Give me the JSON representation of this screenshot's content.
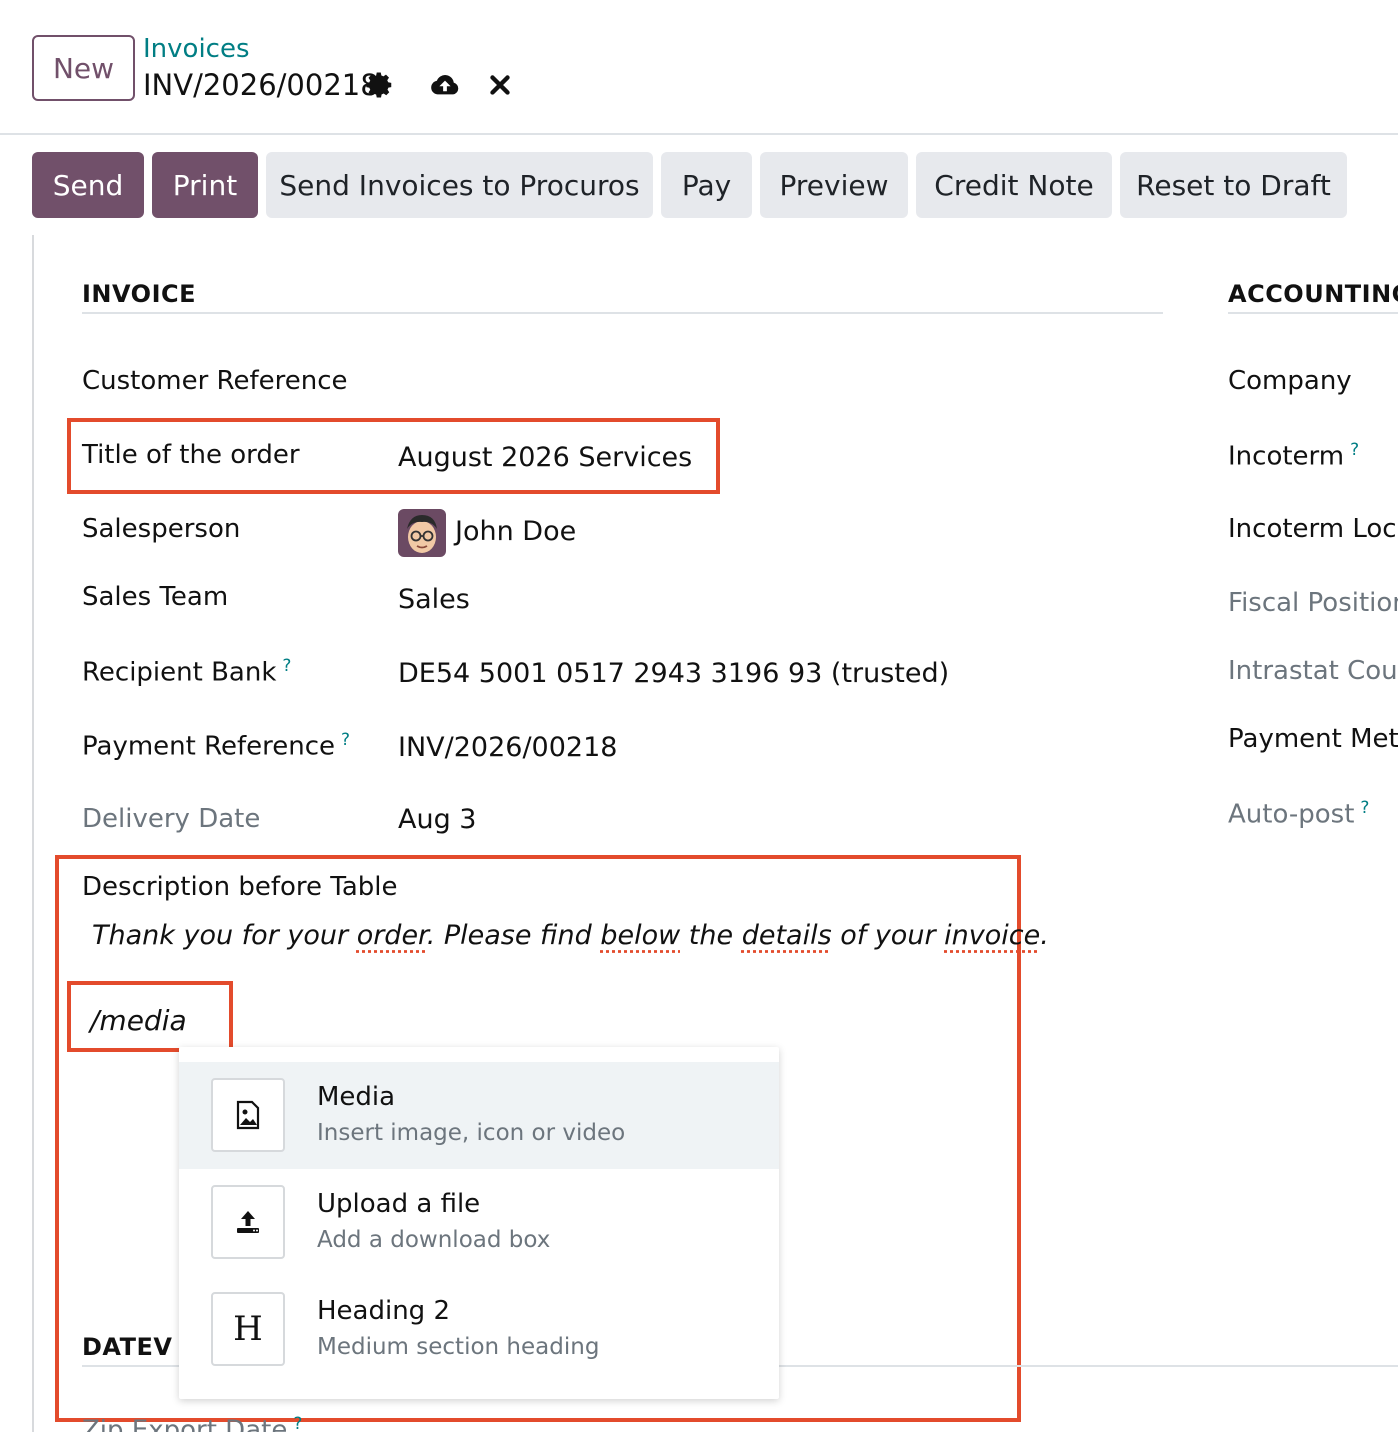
{
  "control_panel": {
    "new_label": "New",
    "breadcrumb": "Invoices",
    "record_name": "INV/2026/00218"
  },
  "status_buttons": [
    {
      "label": "Send",
      "style": "primary"
    },
    {
      "label": "Print",
      "style": "primary"
    },
    {
      "label": "Send Invoices to Procuros",
      "style": "secondary"
    },
    {
      "label": "Pay",
      "style": "secondary"
    },
    {
      "label": "Preview",
      "style": "secondary"
    },
    {
      "label": "Credit Note",
      "style": "secondary"
    },
    {
      "label": "Reset to Draft",
      "style": "secondary"
    }
  ],
  "invoice_section": {
    "title": "INVOICE",
    "fields": {
      "customer_reference": {
        "label": "Customer Reference",
        "value": ""
      },
      "title_of_order": {
        "label": "Title of the order",
        "value": "August 2026 Services"
      },
      "salesperson": {
        "label": "Salesperson",
        "value": "John Doe"
      },
      "sales_team": {
        "label": "Sales Team",
        "value": "Sales"
      },
      "recipient_bank": {
        "label": "Recipient Bank",
        "help": "?",
        "value": "DE54 5001 0517 2943 3196 93 (trusted)"
      },
      "payment_reference": {
        "label": "Payment Reference",
        "help": "?",
        "value": "INV/2026/00218"
      },
      "delivery_date": {
        "label": "Delivery Date",
        "value": "Aug 3"
      }
    },
    "description_label": "Description before Table",
    "description_text": {
      "w1": "Thank you for your ",
      "w2": "order",
      "w3": ". Please find ",
      "w4": "below",
      "w5": " the ",
      "w6": "details",
      "w7": " of your ",
      "w8": "invoice",
      "w9": "."
    },
    "editor_input": "/media"
  },
  "accounting_section": {
    "title": "ACCOUNTING",
    "fields": {
      "company": "Company",
      "incoterm": "Incoterm",
      "incoterm_help": "?",
      "incoterm_location": "Incoterm Location",
      "fiscal_position": "Fiscal Position",
      "intrastat_country": "Intrastat Country",
      "payment_method": "Payment Method",
      "auto_post": "Auto-post",
      "auto_post_help": "?"
    }
  },
  "datev_section": {
    "title": "DATEV",
    "zip_export_label": "Zip Export Date",
    "zip_export_help": "?"
  },
  "powerbox": {
    "items": [
      {
        "title": "Media",
        "description": "Insert image, icon or video",
        "icon": "image-icon"
      },
      {
        "title": "Upload a file",
        "description": "Add a download box",
        "icon": "upload-icon"
      },
      {
        "title": "Heading 2",
        "description": "Medium section heading",
        "icon": "heading-icon",
        "glyph": "H"
      }
    ]
  },
  "colors": {
    "primary": "#71506a",
    "link": "#017e84",
    "highlight_box": "#e34b2c"
  }
}
